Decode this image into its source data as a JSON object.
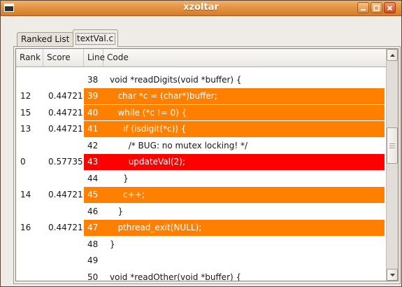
{
  "window": {
    "title": "xzoltar",
    "icon": "window-menu-icon",
    "controls": [
      "minimize-icon",
      "maximize-icon",
      "close-icon"
    ]
  },
  "tabs": [
    {
      "label": "Ranked List",
      "selected": false
    },
    {
      "label": "textVal.c",
      "selected": true
    }
  ],
  "table": {
    "columns": {
      "rank": "Rank",
      "score": "Score",
      "line": "Line",
      "code": "Code"
    },
    "rows": [
      {
        "rank": "",
        "score": "",
        "line": "38",
        "code": "void *readDigits(void *buffer) {",
        "highlight": null
      },
      {
        "rank": "12",
        "score": "0.44721",
        "line": "39",
        "code": "   char *c = (char*)buffer;",
        "highlight": "orange"
      },
      {
        "rank": "15",
        "score": "0.44721",
        "line": "40",
        "code": "   while (*c != 0) {",
        "highlight": "orange"
      },
      {
        "rank": "13",
        "score": "0.44721",
        "line": "41",
        "code": "     if (isdigit(*c)) {",
        "highlight": "orange"
      },
      {
        "rank": "",
        "score": "",
        "line": "42",
        "code": "       /* BUG: no mutex locking! */",
        "highlight": null
      },
      {
        "rank": "0",
        "score": "0.57735",
        "line": "43",
        "code": "       updateVal(2);",
        "highlight": "red"
      },
      {
        "rank": "",
        "score": "",
        "line": "44",
        "code": "     }",
        "highlight": null
      },
      {
        "rank": "14",
        "score": "0.44721",
        "line": "45",
        "code": "     c++;",
        "highlight": "orange"
      },
      {
        "rank": "",
        "score": "",
        "line": "46",
        "code": "   }",
        "highlight": null
      },
      {
        "rank": "16",
        "score": "0.44721",
        "line": "47",
        "code": "   pthread_exit(NULL);",
        "highlight": "orange"
      },
      {
        "rank": "",
        "score": "",
        "line": "48",
        "code": "}",
        "highlight": null
      },
      {
        "rank": "",
        "score": "",
        "line": "49",
        "code": "",
        "highlight": null
      },
      {
        "rank": "",
        "score": "",
        "line": "50",
        "code": "void *readOther(void *buffer) {",
        "highlight": null
      }
    ]
  },
  "scrollbar": {
    "up_icon": "arrow-up-icon",
    "down_icon": "arrow-down-icon"
  },
  "colors": {
    "orange": "#ff7f00",
    "red": "#fd0000",
    "highlight_text": "#ffffff"
  }
}
